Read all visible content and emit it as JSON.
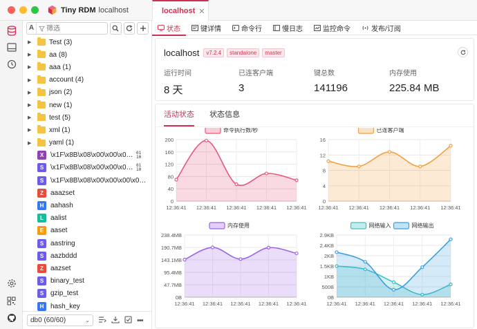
{
  "app": {
    "name": "Tiny RDM",
    "connection": "localhost"
  },
  "tab": {
    "label": "localhost",
    "close": "✕"
  },
  "search": {
    "placeholder": "筛选",
    "type_selector": "A"
  },
  "tree": {
    "folders": [
      {
        "label": "Test (3)"
      },
      {
        "label": "aa (8)"
      },
      {
        "label": "aaa (1)"
      },
      {
        "label": "account (4)"
      },
      {
        "label": "json (2)"
      },
      {
        "label": "new (1)"
      },
      {
        "label": "test (5)"
      },
      {
        "label": "xml (1)"
      },
      {
        "label": "yaml (1)"
      }
    ],
    "keys": [
      {
        "type": "X",
        "color": "#8e44ad",
        "name": "\\x1F\\x8B\\x08\\x00\\x00\\x00\\x00...",
        "binary": true
      },
      {
        "type": "S",
        "color": "#6c5ce7",
        "name": "\\x1F\\x8B\\x08\\x00\\x00\\x09n\\x88...",
        "binary": true
      },
      {
        "type": "S",
        "color": "#6c5ce7",
        "name": "\\x1F\\x8B\\x08\\x00\\x00\\x00\\x00\\x0...",
        "binary": false
      },
      {
        "type": "Z",
        "color": "#e74c3c",
        "name": "aaazset",
        "binary": false
      },
      {
        "type": "H",
        "color": "#3478f6",
        "name": "aahash",
        "binary": false
      },
      {
        "type": "L",
        "color": "#1abc9c",
        "name": "aalist",
        "binary": false
      },
      {
        "type": "E",
        "color": "#f39c12",
        "name": "aaset",
        "binary": false
      },
      {
        "type": "S",
        "color": "#6c5ce7",
        "name": "aastring",
        "binary": false
      },
      {
        "type": "S",
        "color": "#6c5ce7",
        "name": "aazbddd",
        "binary": false
      },
      {
        "type": "Z",
        "color": "#e74c3c",
        "name": "aazset",
        "binary": false
      },
      {
        "type": "S",
        "color": "#6c5ce7",
        "name": "binary_test",
        "binary": false
      },
      {
        "type": "S",
        "color": "#6c5ce7",
        "name": "gzip_test",
        "binary": false
      },
      {
        "type": "H",
        "color": "#3478f6",
        "name": "hash_key",
        "binary": false
      }
    ]
  },
  "db_select": {
    "value": "db0 (60/60)"
  },
  "subtabs": [
    "状态",
    "键详情",
    "命令行",
    "慢日志",
    "监控命令",
    "发布/订阅"
  ],
  "server": {
    "host": "localhost",
    "tags": [
      "v7.2.4",
      "standalone",
      "master"
    ],
    "stats": [
      {
        "label": "运行时间",
        "value": "8 天"
      },
      {
        "label": "已连客户端",
        "value": "3"
      },
      {
        "label": "键总数",
        "value": "141196"
      },
      {
        "label": "内存使用",
        "value": "225.84 MB"
      }
    ]
  },
  "content_tabs": [
    "活动状态",
    "状态信息"
  ],
  "colors": {
    "accent": "#d03050"
  },
  "chart_data": [
    {
      "type": "area",
      "x": [
        "12:36:41",
        "12:36:41",
        "12:36:41",
        "12:36:41",
        "12:36:41"
      ],
      "series": [
        {
          "name": "命令执行数/秒",
          "values": [
            70,
            197,
            55,
            90,
            68
          ],
          "color": "#e8587a"
        }
      ],
      "ylim": [
        0,
        200
      ],
      "yticks": [
        "0",
        "40",
        "80",
        "120",
        "160",
        "200"
      ]
    },
    {
      "type": "area",
      "x": [
        "12:36:41",
        "12:36:41",
        "12:36:41",
        "12:36:41",
        "12:36:41"
      ],
      "series": [
        {
          "name": "已连客户端",
          "values": [
            13,
            11.3,
            16,
            11.3,
            18
          ],
          "color": "#f0a040"
        }
      ],
      "ylim": [
        0,
        20
      ],
      "yticks": [
        "0",
        "4",
        "8",
        "12",
        "16"
      ]
    },
    {
      "type": "area",
      "x": [
        "12:36:41",
        "12:36:41",
        "12:36:41",
        "12:36:41",
        "12:36:41"
      ],
      "series": [
        {
          "name": "内存使用",
          "values": [
            144,
            191,
            146,
            190,
            168
          ],
          "color": "#9b63e8"
        }
      ],
      "ylim": [
        0,
        238.4
      ],
      "yticks": [
        "0B",
        "47.7MB",
        "95.4MB",
        "143.1MB",
        "190.7MB",
        "238.4MB"
      ]
    },
    {
      "type": "area",
      "x": [
        "12:36:41",
        "12:36:41",
        "12:36:41",
        "12:36:41",
        "12:36:41"
      ],
      "series": [
        {
          "name": "网络输入",
          "values": [
            1.45,
            1.3,
            0.7,
            0.12,
            0.6
          ],
          "color": "#3ec1c1"
        },
        {
          "name": "网络输出",
          "values": [
            2.1,
            1.65,
            0.35,
            1.4,
            2.7
          ],
          "color": "#3a9ee0"
        }
      ],
      "ylim": [
        0,
        2.9
      ],
      "yticks": [
        "0B",
        "500B",
        "1KB",
        "1.5KB",
        "2KB",
        "2.4KB",
        "2.9KB"
      ]
    }
  ]
}
